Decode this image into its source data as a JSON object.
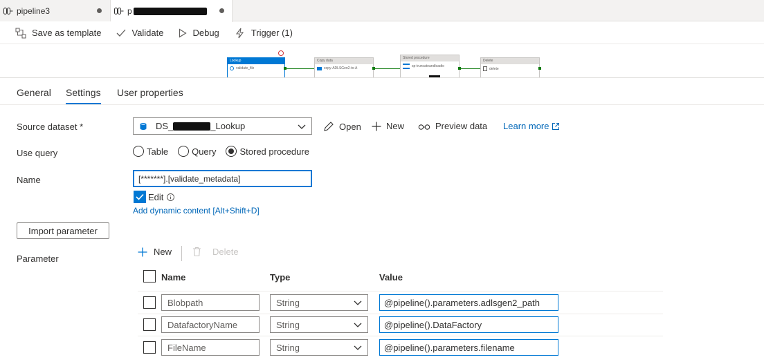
{
  "tabs": [
    {
      "label": "pipeline3"
    },
    {
      "label": "p"
    }
  ],
  "toolbar": {
    "save_template": "Save as template",
    "validate": "Validate",
    "debug": "Debug",
    "trigger": "Trigger (1)"
  },
  "canvas": {
    "activities": [
      {
        "type": "Lookup",
        "name": "validate_file"
      },
      {
        "type": "Copy data",
        "name": "copy-ADLSGen2-to-A"
      },
      {
        "type": "Stored procedure",
        "name": "sp-truncateandloadto"
      },
      {
        "type": "Delete",
        "name": "delete"
      }
    ]
  },
  "property_tabs": {
    "general": "General",
    "settings": "Settings",
    "user_properties": "User properties"
  },
  "form": {
    "source_dataset_label": "Source dataset",
    "required_mark": "*",
    "dataset_prefix": "DS_",
    "dataset_suffix": "_Lookup",
    "open": "Open",
    "new": "New",
    "preview": "Preview data",
    "learn_more": "Learn more",
    "use_query_label": "Use query",
    "query_options": [
      "Table",
      "Query",
      "Stored procedure"
    ],
    "selected_query": "Stored procedure",
    "name_label": "Name",
    "name_value": "[*******].[validate_metadata]",
    "edit_label": "Edit",
    "edit_checked": true,
    "dynamic_content": "Add dynamic content [Alt+Shift+D]",
    "import_parameter": "Import parameter",
    "parameter_label": "Parameter",
    "param_new": "New",
    "param_delete": "Delete"
  },
  "params_table": {
    "headers": {
      "name": "Name",
      "type": "Type",
      "value": "Value"
    },
    "rows": [
      {
        "name": "Blobpath",
        "type": "String",
        "value": "@pipeline().parameters.adlsgen2_path"
      },
      {
        "name": "DatafactoryName",
        "type": "String",
        "value": "@pipeline().DataFactory"
      },
      {
        "name": "FileName",
        "type": "String",
        "value": "@pipeline().parameters.filename"
      }
    ]
  },
  "colors": {
    "accent": "#0078d4",
    "success": "#107c10",
    "link": "#0067b8"
  }
}
